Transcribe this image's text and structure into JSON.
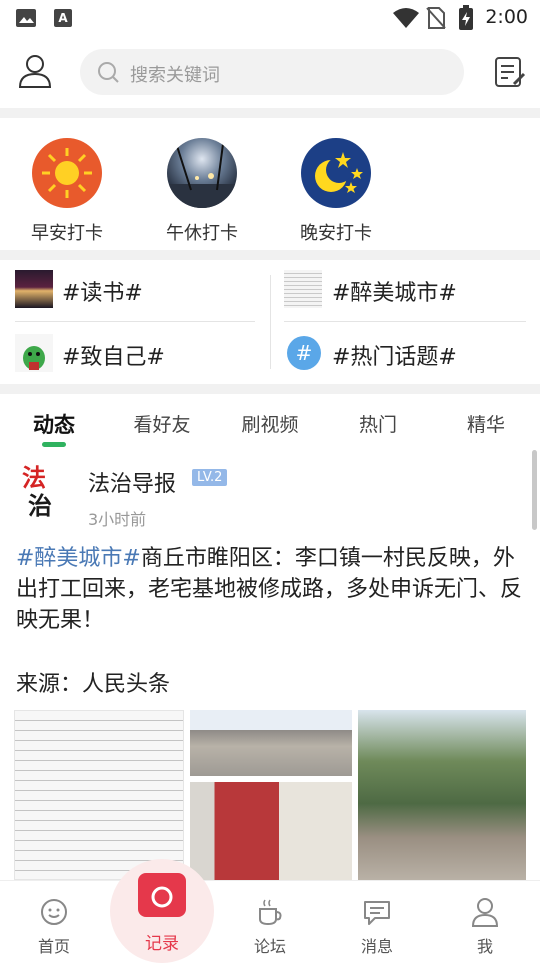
{
  "status": {
    "time": "2:00"
  },
  "search": {
    "placeholder": "搜索关键词"
  },
  "checkin": [
    {
      "label": "早安打卡",
      "icon": "sun-icon"
    },
    {
      "label": "午休打卡",
      "icon": "night-street-icon"
    },
    {
      "label": "晚安打卡",
      "icon": "moon-stars-icon"
    }
  ],
  "topics": [
    {
      "label": "#读书#"
    },
    {
      "label": "#醉美城市#"
    },
    {
      "label": "#致自己#"
    },
    {
      "label": "#热门话题#"
    }
  ],
  "tabs": [
    "动态",
    "看好友",
    "刷视频",
    "热门",
    "精华"
  ],
  "post": {
    "author": "法治导报",
    "level": "LV.2",
    "time": "3小时前",
    "hashtag": "#醉美城市#",
    "body": "商丘市睢阳区：李口镇一村民反映，外出打工回来，老宅基地被修成路，多处申诉无门、反映无果！",
    "source": "来源：人民头条"
  },
  "nav": [
    {
      "label": "首页",
      "icon": "smile-chat-icon"
    },
    {
      "label": "记录",
      "icon": "camera-icon"
    },
    {
      "label": "论坛",
      "icon": "coffee-cup-icon"
    },
    {
      "label": "消息",
      "icon": "message-icon"
    },
    {
      "label": "我",
      "icon": "user-icon"
    }
  ],
  "colors": {
    "accent": "#e5384b",
    "hashtag": "#4a79b5",
    "tab_indicator": "#2fb25f"
  }
}
